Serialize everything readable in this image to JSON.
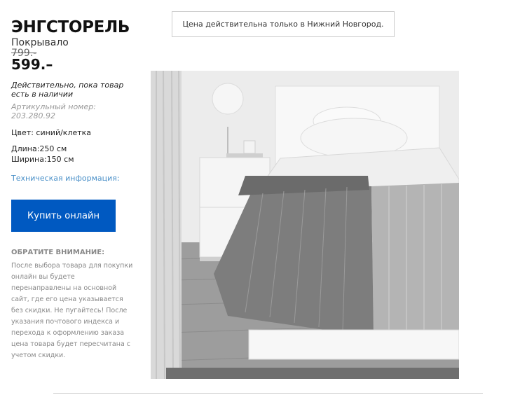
{
  "product": {
    "name": "ЭНГСТОРЕЛЬ",
    "subtitle": "Покрывало",
    "old_price": "799.-",
    "price": "599.–",
    "validity": "Действительно, пока товар есть в наличии",
    "article": "Артикульный номер: 203.280.92",
    "color": "Цвет: синий/клетка",
    "length": "Длина:250 см",
    "width": "Ширина:150 см",
    "tech_link": "Техническая информация:",
    "buy_label": "Купить онлайн",
    "image_icon": "bedspread-product-photo"
  },
  "notice": {
    "title": "ОБРАТИТЕ ВНИМАНИЕ:",
    "text": "После выбора товара для покупки онлайн вы будете перенаправлены на основной сайт, где его цена указывается без скидки. Не пугайтесь! После указания почтового индекса и перехода к оформлению заказа цена товара будет пересчитана с учетом скидки."
  },
  "city_notice": "Цена действительна только в Нижний Новгород.",
  "colors": {
    "button": "#0059c1",
    "link": "#4a90c8",
    "muted": "#888888",
    "border": "#cccccc"
  }
}
